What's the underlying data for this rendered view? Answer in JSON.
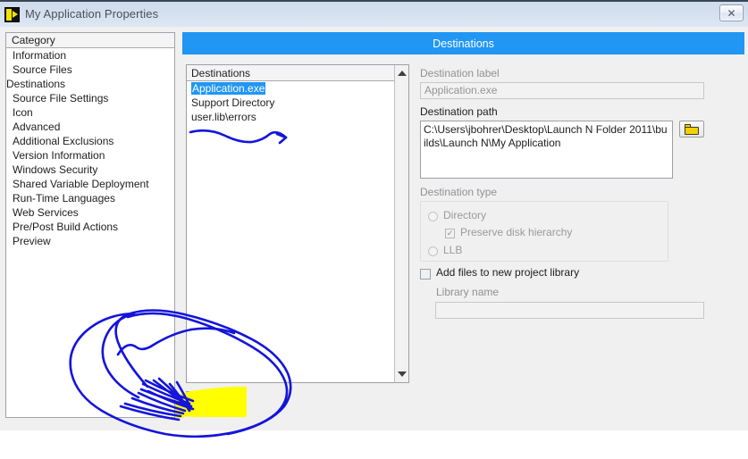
{
  "window": {
    "title": "My Application Properties",
    "icon": "labview-icon",
    "close_label": "✕"
  },
  "category_panel": {
    "header": "Category",
    "selected": "Destinations",
    "items": [
      "Information",
      "Source Files",
      "Destinations",
      "Source File Settings",
      "Icon",
      "Advanced",
      "Additional Exclusions",
      "Version Information",
      "Windows Security",
      "Shared Variable Deployment",
      "Run-Time Languages",
      "Web Services",
      "Pre/Post Build Actions",
      "Preview"
    ]
  },
  "page": {
    "header": "Destinations",
    "header_color": "#2196f3"
  },
  "destinations_list": {
    "header": "Destinations",
    "selected": "Application.exe",
    "items": [
      "Application.exe",
      "Support Directory",
      "user.lib\\errors"
    ]
  },
  "toolbar": {
    "add_label": "+",
    "delete_label": "✕"
  },
  "form": {
    "destination_label_label": "Destination label",
    "destination_label_value": "Application.exe",
    "destination_path_label": "Destination path",
    "destination_path_value": "C:\\Users\\jbohrer\\Desktop\\Launch N Folder 2011\\builds\\Launch N\\My Application",
    "browse_icon": "folder-icon",
    "destination_type_label": "Destination type",
    "radio_directory": "Directory",
    "checkbox_preserve": "Preserve disk hierarchy",
    "preserve_checked": "✓",
    "radio_llb": "LLB",
    "add_files_label": "Add files to new project library",
    "library_name_label": "Library name",
    "library_name_value": ""
  },
  "annotations": {
    "ink_color": "#1414dc",
    "highlight_color": "#ffff00"
  }
}
